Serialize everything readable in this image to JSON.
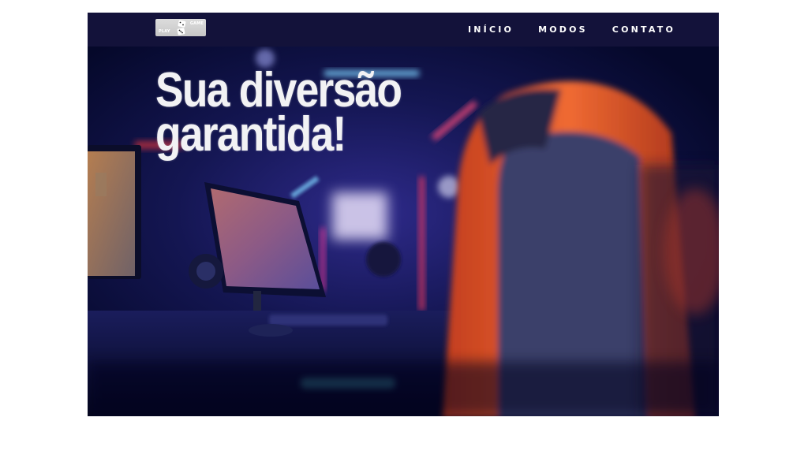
{
  "header": {
    "logo": {
      "text_top": "GAME",
      "text_bottom": "PLAY"
    },
    "nav": [
      {
        "label": "INÍCIO"
      },
      {
        "label": "MODOS"
      },
      {
        "label": "CONTATO"
      }
    ]
  },
  "hero": {
    "title_line1": "Sua diversão",
    "title_line2": "garantida!",
    "background": "gaming-setup-photo"
  },
  "colors": {
    "header_bg": "#13123a",
    "nav_text": "#ffffff",
    "title_text": "#f2f2f4",
    "accent_orange": "#e2572c",
    "accent_neon": "#5b6cff"
  }
}
